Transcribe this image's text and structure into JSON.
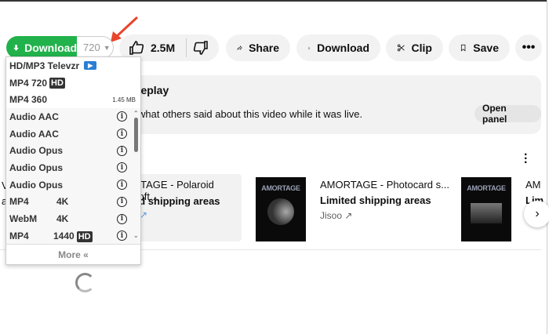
{
  "downloader": {
    "button_label": "Download",
    "quality": "720",
    "more_label": "More «",
    "top_items": [
      {
        "label": "HD/MP3 Televzr"
      },
      {
        "label": "MP4 720",
        "badge": "HD"
      },
      {
        "label": "MP4 360",
        "size": "1.45 MB"
      }
    ],
    "items": [
      {
        "format": "Audio AAC",
        "res": ""
      },
      {
        "format": "Audio AAC",
        "res": ""
      },
      {
        "format": "Audio Opus",
        "res": ""
      },
      {
        "format": "Audio Opus",
        "res": ""
      },
      {
        "format": "Audio Opus",
        "res": ""
      },
      {
        "format": "MP4",
        "res": "4K"
      },
      {
        "format": "WebM",
        "res": "4K"
      },
      {
        "format": "MP4",
        "res": "1440",
        "badge": "HD"
      }
    ],
    "accent": "#21b24b"
  },
  "actions": {
    "likes": "2.5M",
    "share": "Share",
    "download": "Download",
    "clip": "Clip",
    "save": "Save"
  },
  "chat": {
    "title": "replay",
    "desc": "what others said about this video while it was live.",
    "open_panel": "Open panel"
  },
  "products": [
    {
      "title": "RTAGE - Polaroid soft...",
      "sub": "ed shipping areas"
    },
    {
      "title": "AMORTAGE - Photocard s...",
      "sub": "Limited shipping areas",
      "seller": "Jisoo",
      "thumb_text": "AMORTAGE"
    },
    {
      "title": "AM",
      "sub": "Lim",
      "thumb_text": "AMORTAGE"
    }
  ],
  "edge_text": [
    "V",
    "a"
  ]
}
